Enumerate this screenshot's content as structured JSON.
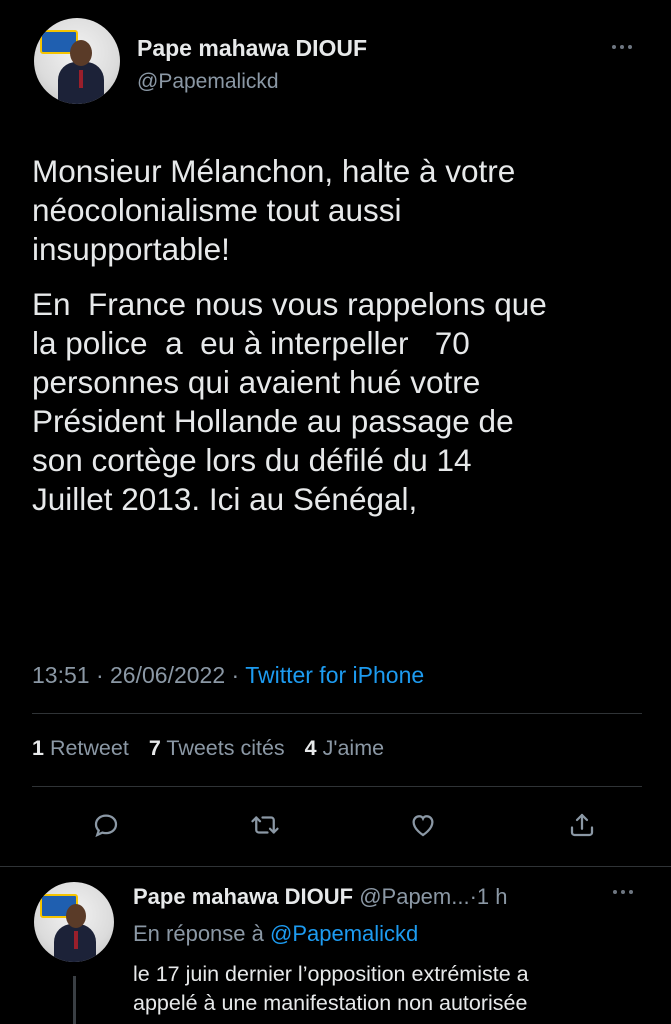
{
  "tweet": {
    "author_name": "Pape mahawa DIOUF",
    "author_handle": "@Papemalickd",
    "paragraphs": [
      "Monsieur Mélanchon, halte à votre\nnéocolonialisme tout aussi\ninsupportable!",
      "En  France nous vous rappelons que\nla police  a  eu à interpeller   70\npersonnes qui avaient hué votre\nPrésident Hollande au passage de\nson cortège lors du défilé du 14\nJuillet 2013. Ici au Sénégal,"
    ],
    "time": "13:51",
    "date": "26/06/2022",
    "separator": "·",
    "source": "Twitter for iPhone",
    "stats": {
      "retweets_count": "1",
      "retweets_label": "Retweet",
      "quotes_count": "7",
      "quotes_label": "Tweets cités",
      "likes_count": "4",
      "likes_label": "J'aime"
    },
    "actions": [
      "reply-icon",
      "retweet-icon",
      "like-icon",
      "share-icon"
    ]
  },
  "reply": {
    "author_name": "Pape mahawa DIOUF",
    "author_handle_truncated": "@Papem...",
    "time_ago": "1 h",
    "reply_prefix": "En réponse à",
    "reply_mention": "@Papemalickd",
    "text_lines": [
      "le 17 juin dernier l’opposition extrémiste a",
      "appelé à une manifestation non autorisée"
    ]
  },
  "colors": {
    "background": "#000000",
    "text": "#e7e9ea",
    "secondary": "#8b98a5",
    "accent": "#1d9bf0",
    "divider": "#2f3336"
  }
}
